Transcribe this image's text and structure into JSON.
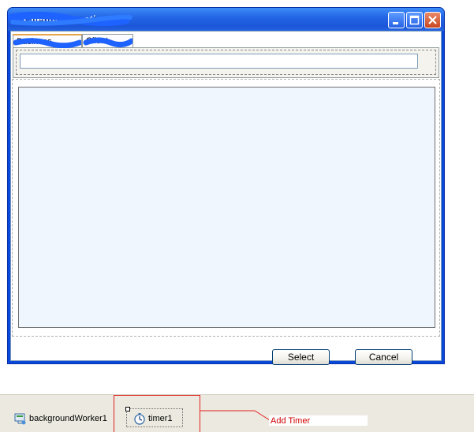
{
  "window": {
    "title": "ClientInformation",
    "buttons": {
      "minimize_icon": "minimize-icon",
      "maximize_icon": "maximize-icon",
      "close_icon": "close-icon"
    }
  },
  "tabs": [
    {
      "label": "Business"
    },
    {
      "label": "Client"
    }
  ],
  "search_input": {
    "value": "",
    "placeholder": ""
  },
  "actions": {
    "select_label": "Select",
    "cancel_label": "Cancel"
  },
  "component_tray": {
    "items": [
      {
        "label": "backgroundWorker1",
        "icon": "background-worker-icon"
      },
      {
        "label": "timer1",
        "icon": "timer-icon"
      }
    ]
  },
  "annotation": {
    "text": "Add Timer",
    "color": "#d00000"
  },
  "colors": {
    "titlebar": "#2466e6",
    "list_panel_bg": "#f0f6fe",
    "tab_active_accent": "#e7a54a",
    "tray_bg": "#eceae0",
    "annotation_line": "#e02020"
  }
}
